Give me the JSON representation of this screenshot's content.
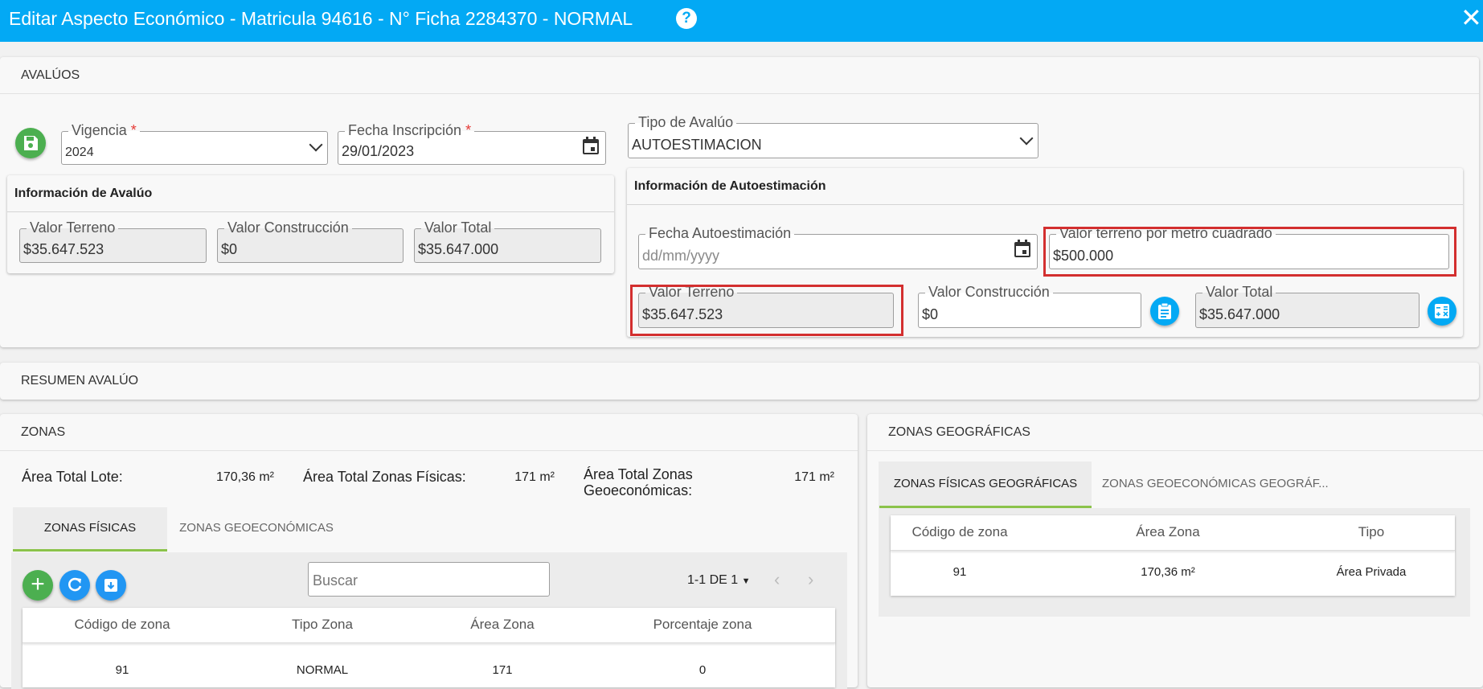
{
  "window": {
    "title": "Editar Aspecto Económico - Matricula 94616 - N° Ficha 2284370 - NORMAL",
    "help_glyph": "?",
    "close_glyph": "✕"
  },
  "avaluos": {
    "section_title": "AVALÚOS",
    "vigencia": {
      "label": "Vigencia",
      "required": "*",
      "value": "2024"
    },
    "fecha_inscripcion": {
      "label": "Fecha Inscripción",
      "required": "*",
      "value": "29/01/2023"
    },
    "tipo_avaluo": {
      "label": "Tipo de Avalúo",
      "value": "AUTOESTIMACION"
    },
    "info_avaluo": {
      "title": "Información de Avalúo",
      "valor_terreno": {
        "label": "Valor Terreno",
        "value": "$35.647.523"
      },
      "valor_construccion": {
        "label": "Valor Construcción",
        "value": "$0"
      },
      "valor_total": {
        "label": "Valor Total",
        "value": "$35.647.000"
      }
    },
    "info_autoestimacion": {
      "title": "Información de Autoestimación",
      "fecha_autoestimacion": {
        "label": "Fecha Autoestimación",
        "placeholder": "dd/mm/yyyy"
      },
      "valor_m2": {
        "label": "Valor terreno por metro cuadrado",
        "value": "$500.000"
      },
      "valor_terreno": {
        "label": "Valor Terreno",
        "value": "$35.647.523"
      },
      "valor_construccion": {
        "label": "Valor Construcción",
        "value": "$0"
      },
      "valor_total": {
        "label": "Valor Total",
        "value": "$35.647.000"
      }
    }
  },
  "resumen": {
    "section_title": "RESUMEN AVALÚO"
  },
  "zonas": {
    "section_title": "ZONAS",
    "area_lote": {
      "label": "Área Total Lote:",
      "value": "170,36 m²"
    },
    "area_fisicas": {
      "label": "Área Total Zonas Físicas:",
      "value": "171 m²"
    },
    "area_geo": {
      "label_line1": "Área Total Zonas",
      "label_line2": "Geoeconómicas:",
      "value": "171 m²"
    },
    "tabs": [
      {
        "label": "ZONAS FÍSICAS",
        "active": true
      },
      {
        "label": "ZONAS GEOECONÓMICAS",
        "active": false
      }
    ],
    "search_placeholder": "Buscar",
    "pagination": "1-1 DE 1",
    "columns": [
      "Código de zona",
      "Tipo Zona",
      "Área Zona",
      "Porcentaje zona"
    ],
    "rows": [
      [
        "91",
        "NORMAL",
        "171",
        "0"
      ]
    ]
  },
  "zonas_geo": {
    "section_title": "ZONAS GEOGRÁFICAS",
    "tabs": [
      {
        "label": "ZONAS FÍSICAS GEOGRÁFICAS",
        "active": true
      },
      {
        "label": "ZONAS GEOECONÓMICAS GEOGRÁF...",
        "active": false
      }
    ],
    "columns": [
      "Código de zona",
      "Área Zona",
      "Tipo"
    ],
    "rows": [
      [
        "91",
        "170,36 m²",
        "Área Privada"
      ]
    ]
  },
  "colors": {
    "header": "#03a9f4",
    "save": "#4caf50",
    "add": "#4caf50",
    "refresh": "#2196f3",
    "highlight": "#d32f2f",
    "tab_active": "#8bc34a"
  }
}
